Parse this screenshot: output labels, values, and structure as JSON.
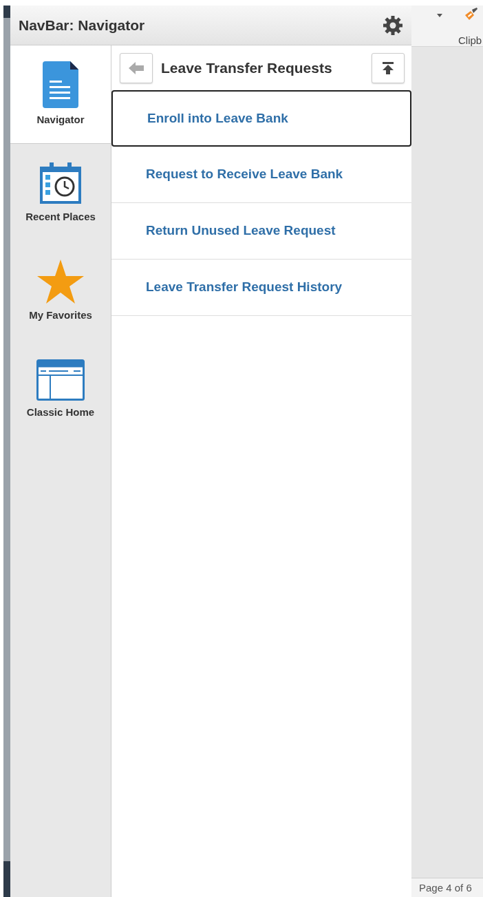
{
  "navbar": {
    "title": "NavBar: Navigator"
  },
  "sidebar": {
    "items": [
      {
        "label": "Navigator",
        "kind": "document",
        "selected": true
      },
      {
        "label": "Recent Places",
        "kind": "calendar",
        "selected": false
      },
      {
        "label": "My Favorites",
        "kind": "star",
        "selected": false
      },
      {
        "label": "Classic Home",
        "kind": "window",
        "selected": false
      }
    ]
  },
  "folder": {
    "title": "Leave Transfer Requests",
    "items": [
      {
        "label": "Enroll into Leave Bank",
        "selected": true
      },
      {
        "label": "Request to Receive Leave Bank",
        "selected": false
      },
      {
        "label": "Return Unused Leave Request",
        "selected": false
      },
      {
        "label": "Leave Transfer Request History",
        "selected": false
      }
    ]
  },
  "ribbon": {
    "group_label": "Clipb"
  },
  "status_bar": {
    "page": "Page 4 of 6"
  }
}
